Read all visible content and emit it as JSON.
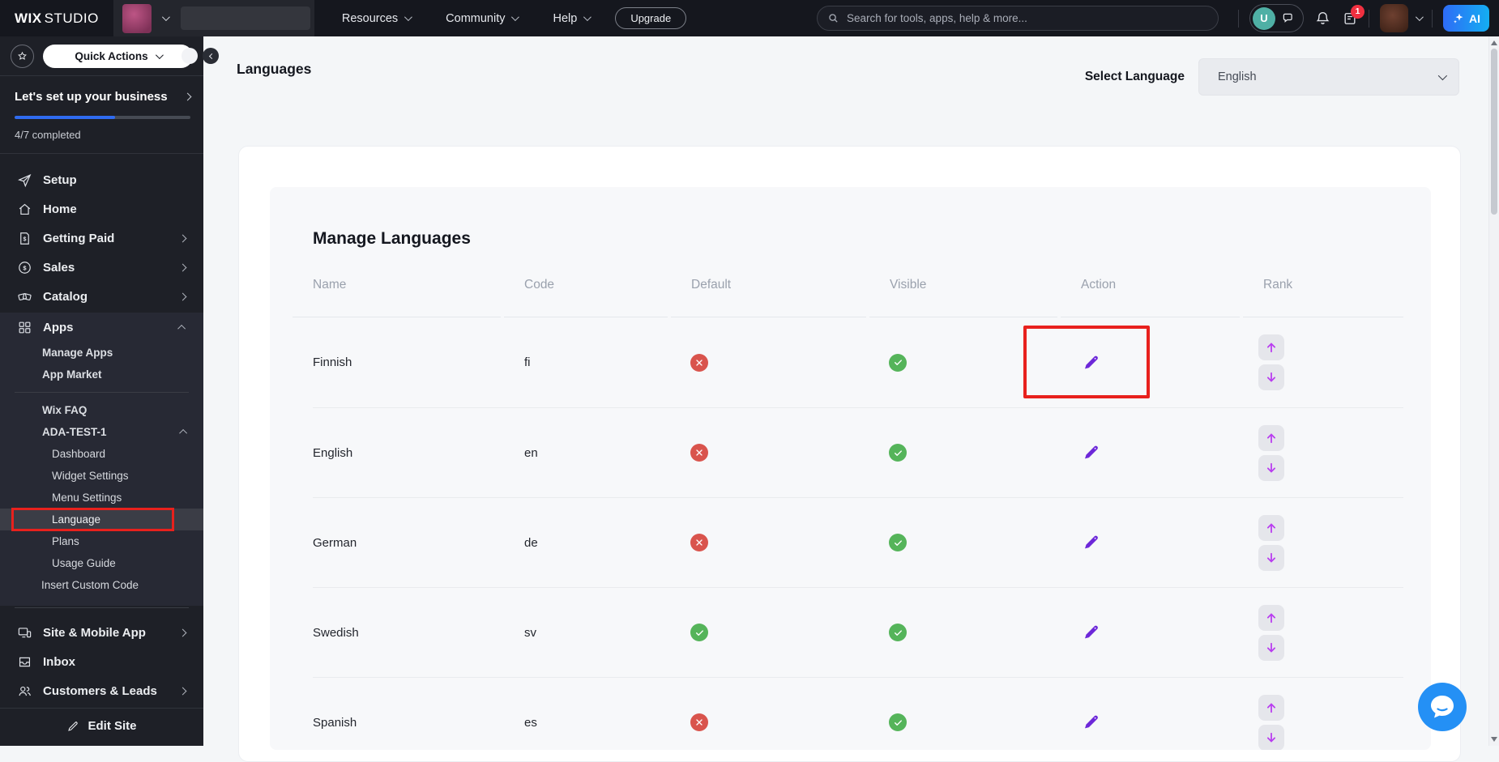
{
  "colors": {
    "topbar_bg": "#15171e",
    "sidebar_bg": "#1e2027",
    "accent_blue": "#2f6bf0",
    "ai_gradient_start": "#2e6cf6",
    "ai_gradient_end": "#14aef2",
    "action_purple": "#6d28d9",
    "rank_arrow_purple": "#b93df0",
    "status_red": "#d9544d",
    "status_green": "#55b45a",
    "highlight_red": "#e8211d",
    "chat_fab_blue": "#2490f5"
  },
  "icons": {
    "star-icon": "outline star in circle",
    "rocket-icon": "launch rocket",
    "home-icon": "house",
    "invoice-icon": "document with dollar",
    "dollar-circle-icon": "dollar in circle",
    "tags-icon": "two tickets",
    "apps-grid-icon": "grid of squares",
    "devices-icon": "monitor and phone",
    "inbox-icon": "inbox tray",
    "people-icon": "two people",
    "pencil-icon": "pencil",
    "search-icon": "magnifier",
    "chat-icon": "speech bubble",
    "bell-icon": "bell",
    "document-icon": "clipboard with lines",
    "sparkle-icon": "four point star",
    "chevron": "angle bracket"
  },
  "topbar": {
    "logo_primary": "WIX",
    "logo_secondary": "STUDIO",
    "nav_items": [
      {
        "label": "Resources"
      },
      {
        "label": "Community"
      },
      {
        "label": "Help"
      }
    ],
    "upgrade_label": "Upgrade",
    "search_placeholder": "Search for tools, apps, help & more...",
    "user_initial": "U",
    "notification_count": "1",
    "ai_button_label": "AI"
  },
  "sidebar": {
    "quick_actions_label": "Quick Actions",
    "setup_progress": {
      "title": "Let's set up your business",
      "completed_label": "4/7 completed",
      "percent": 57
    },
    "items_top": [
      {
        "label": "Setup"
      },
      {
        "label": "Home"
      },
      {
        "label": "Getting Paid"
      },
      {
        "label": "Sales"
      },
      {
        "label": "Catalog"
      }
    ],
    "apps": {
      "label": "Apps",
      "submenu": [
        {
          "label": "Manage Apps"
        },
        {
          "label": "App Market"
        }
      ]
    },
    "app_section": {
      "faq_label": "Wix FAQ",
      "app_name": "ADA-TEST-1",
      "submenu": [
        {
          "label": "Dashboard"
        },
        {
          "label": "Widget Settings"
        },
        {
          "label": "Menu Settings"
        },
        {
          "label": "Language",
          "highlighted": true
        },
        {
          "label": "Plans"
        },
        {
          "label": "Usage Guide"
        },
        {
          "label": "Insert Custom Code"
        }
      ]
    },
    "items_bottom": [
      {
        "label": "Site & Mobile App"
      },
      {
        "label": "Inbox"
      },
      {
        "label": "Customers & Leads"
      }
    ],
    "edit_site_label": "Edit Site"
  },
  "main": {
    "page_title": "Languages",
    "language_selector": {
      "label": "Select Language",
      "value": "English"
    },
    "card": {
      "title": "Manage Languages",
      "table": {
        "columns": [
          "Name",
          "Code",
          "Default",
          "Visible",
          "Action",
          "Rank"
        ],
        "rows": [
          {
            "name": "Finnish",
            "code": "fi",
            "default": false,
            "visible": true,
            "action_highlighted": true
          },
          {
            "name": "English",
            "code": "en",
            "default": false,
            "visible": true,
            "action_highlighted": false
          },
          {
            "name": "German",
            "code": "de",
            "default": false,
            "visible": true,
            "action_highlighted": false
          },
          {
            "name": "Swedish",
            "code": "sv",
            "default": true,
            "visible": true,
            "action_highlighted": false
          },
          {
            "name": "Spanish",
            "code": "es",
            "default": false,
            "visible": true,
            "action_highlighted": false
          }
        ]
      }
    }
  }
}
